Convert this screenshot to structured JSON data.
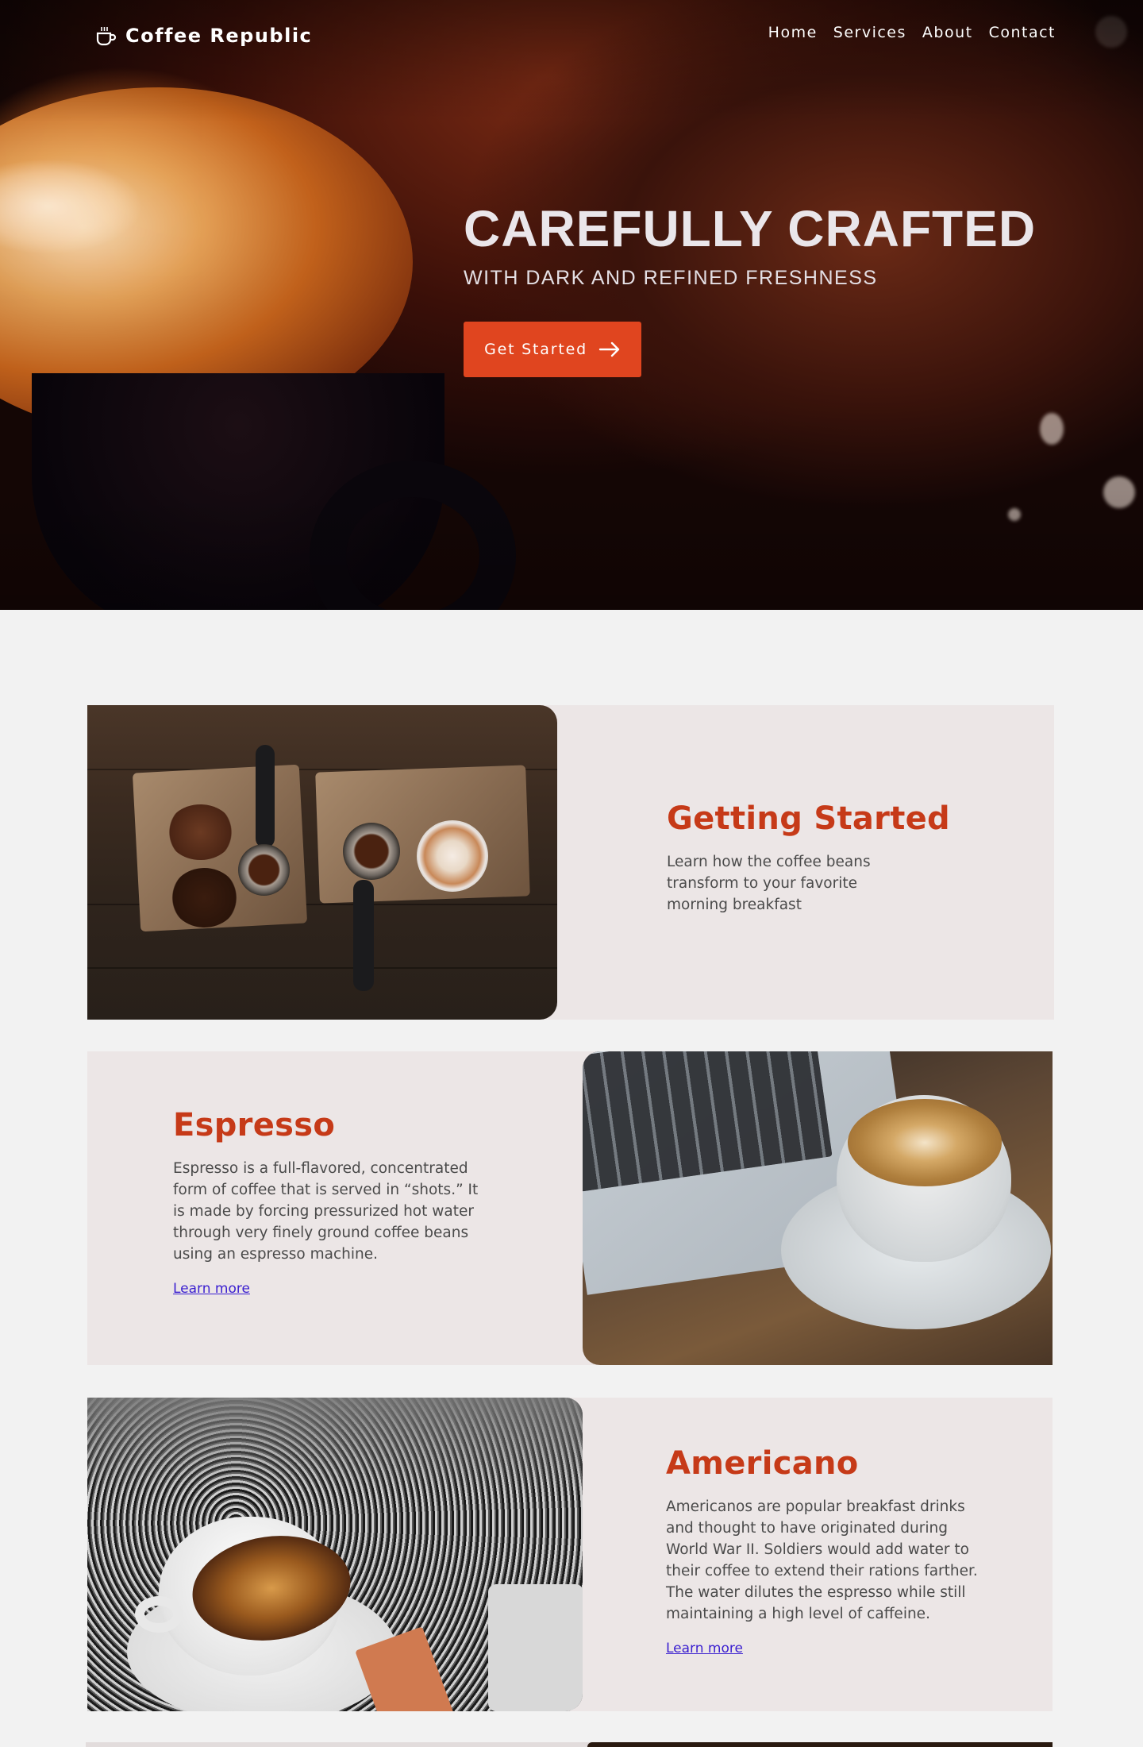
{
  "brand": {
    "name": "Coffee Republic",
    "icon": "coffee-cup-icon"
  },
  "nav": {
    "items": [
      {
        "label": "Home"
      },
      {
        "label": "Services"
      },
      {
        "label": "About"
      },
      {
        "label": "Contact"
      }
    ]
  },
  "hero": {
    "title": "CAREFULLY CRAFTED",
    "subtitle": "WITH DARK AND REFINED FRESHNESS",
    "cta_label": "Get Started",
    "cta_icon": "arrow-right-icon"
  },
  "cards": [
    {
      "title": "Getting Started",
      "body": "Learn how the coffee beans transform to your favorite morning breakfast"
    },
    {
      "title": "Espresso",
      "body": "Espresso is a full-flavored, concentrated form of coffee that is served in “shots.” It is made by forcing pressurized hot water through very finely ground coffee beans using an espresso machine.",
      "link": "Learn more"
    },
    {
      "title": "Americano",
      "body": "Americanos are popular breakfast drinks and thought to have originated during World War II. Soldiers would add water to their coffee to extend their rations farther. The water dilutes the espresso while still maintaining a high level of caffeine.",
      "link": "Learn more"
    }
  ],
  "colors": {
    "accent": "#e0451f",
    "heading": "#c63a18",
    "card_bg": "#ece6e6",
    "page_bg": "#f2f2f2",
    "link": "#3a1fd0"
  }
}
